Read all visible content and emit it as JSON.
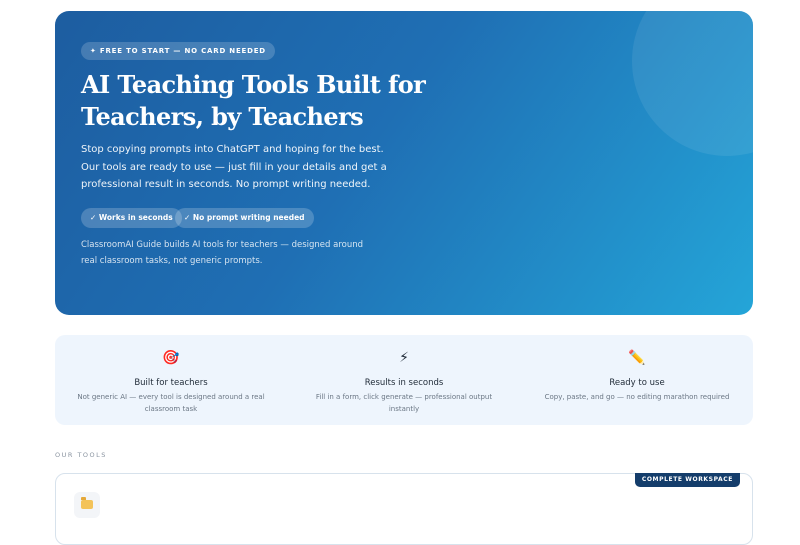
{
  "hero": {
    "badge": "✦ FREE TO START — NO CARD NEEDED",
    "title": "AI Teaching Tools Built for Teachers, by Teachers",
    "description": "Stop copying prompts into ChatGPT and hoping for the best. Our tools are ready to use — just fill in your details and get a professional result in seconds. No prompt writing needed.",
    "pills": [
      "✓ Works in seconds",
      "✓ No prompt writing needed"
    ],
    "note": "ClassroomAI Guide builds AI tools for teachers — designed around real classroom tasks, not generic prompts."
  },
  "features": [
    {
      "icon": "target-icon",
      "glyph": "🎯",
      "title": "Built for teachers",
      "description": "Not generic AI — every tool is designed around a real classroom task"
    },
    {
      "icon": "lightning-icon",
      "glyph": "⚡",
      "title": "Results in seconds",
      "description": "Fill in a form, click generate — professional output instantly"
    },
    {
      "icon": "pencil-icon",
      "glyph": "✏️",
      "title": "Ready to use",
      "description": "Copy, paste, and go — no editing marathon required"
    }
  ],
  "tools": {
    "section_label": "OUR TOOLS",
    "card": {
      "badge": "COMPLETE WORKSPACE",
      "icon": "folder-icon"
    }
  },
  "colors": {
    "hero_start": "#1d5da0",
    "hero_end": "#24a5d8",
    "feature_bg": "#eef5fd",
    "badge_dark": "#143d6b"
  }
}
